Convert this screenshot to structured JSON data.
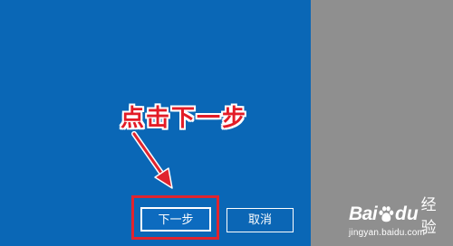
{
  "dialog": {
    "next_button_label": "下一步",
    "cancel_button_label": "取消"
  },
  "annotation": {
    "label": "点击下一步",
    "color": "#e31c27"
  },
  "watermark": {
    "logo_text_1": "Bai",
    "logo_text_2": "du",
    "logo_text_3": "经验",
    "url": "jingyan.baidu.com"
  },
  "colors": {
    "dialog_background": "#0a67b6",
    "side_panel": "#8f8f8f",
    "highlight_border": "#e0242e"
  }
}
